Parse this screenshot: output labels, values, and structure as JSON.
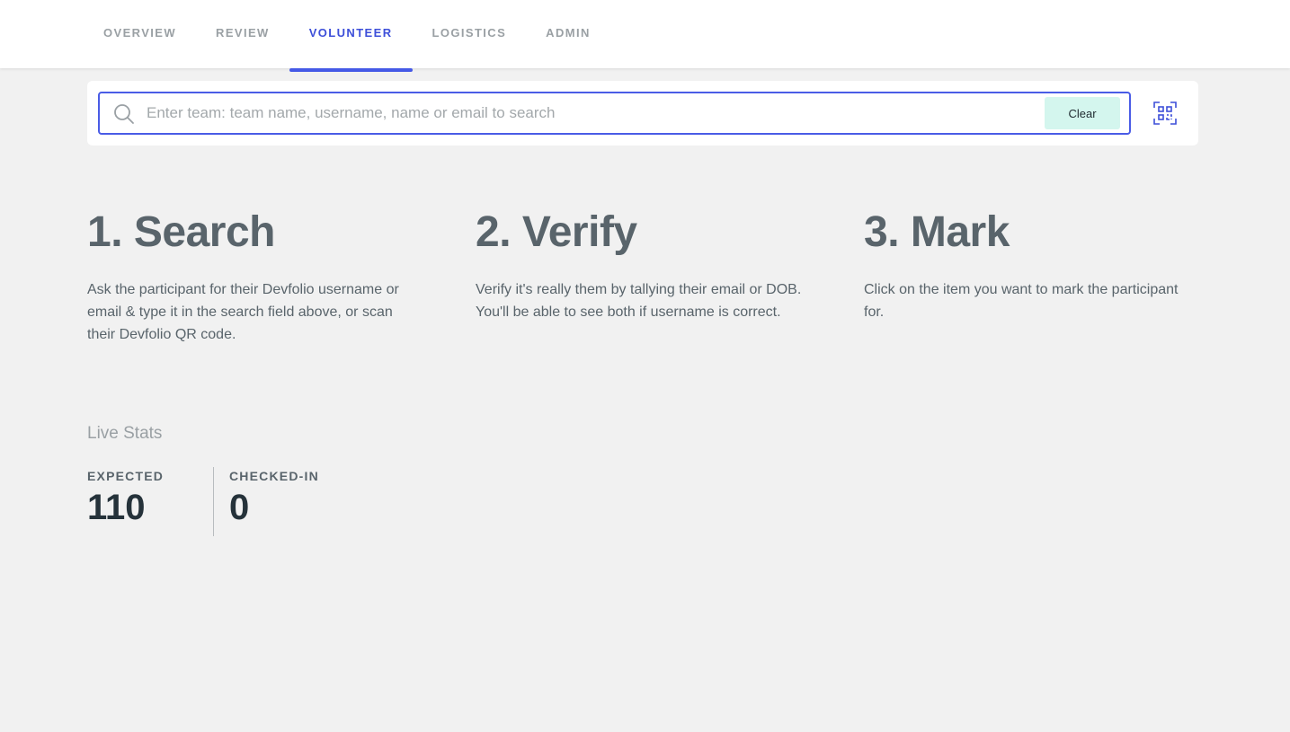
{
  "nav": {
    "tabs": [
      {
        "label": "OVERVIEW",
        "active": false
      },
      {
        "label": "REVIEW",
        "active": false
      },
      {
        "label": "VOLUNTEER",
        "active": true
      },
      {
        "label": "LOGISTICS",
        "active": false
      },
      {
        "label": "ADMIN",
        "active": false
      }
    ]
  },
  "search": {
    "placeholder": "Enter team: team name, username, name or email to search",
    "value": "",
    "clear_label": "Clear",
    "icon": "search-icon",
    "qr_icon": "qr-scan-icon"
  },
  "steps": [
    {
      "title": "1. Search",
      "text": "Ask the participant for their Devfolio username or email & type it in the search field above, or scan their Devfolio QR code."
    },
    {
      "title": "2. Verify",
      "text": "Verify it's really them by tallying their email or DOB. You'll be able to see both if username is correct."
    },
    {
      "title": "3. Mark",
      "text": "Click on the item you want to mark the participant for."
    }
  ],
  "stats": {
    "title": "Live Stats",
    "expected_label": "EXPECTED",
    "expected_value": "110",
    "checked_in_label": "CHECKED-IN",
    "checked_in_value": "0"
  },
  "colors": {
    "accent": "#4559e6",
    "clear_bg": "#d4f6ee",
    "background": "#f1f1f1"
  }
}
